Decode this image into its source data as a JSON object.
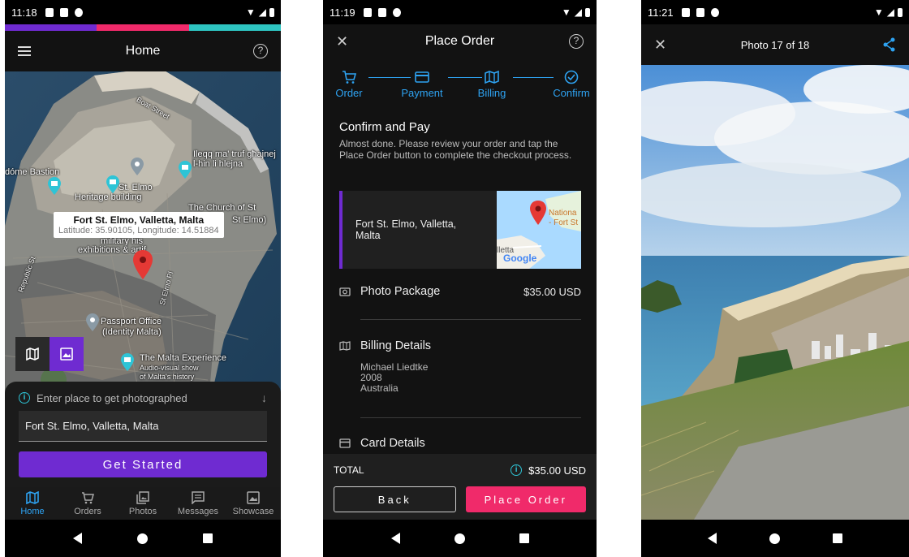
{
  "home": {
    "status": {
      "time": "11:18"
    },
    "stripe": {
      "colors": [
        "#6f2bd1",
        "#f02a6a",
        "#2ec4c1"
      ]
    },
    "header": {
      "title": "Home"
    },
    "map": {
      "labels": {
        "bastion": "dóme Bastion",
        "st_elmo": "St. Elmo",
        "heritage": "Heritage building",
        "church": "The Church of St",
        "church2": "St Elmo)",
        "ileqq": "Ileqq ma' truf għajnej",
        "ilhin": "l-hin li hlejna",
        "military": "military his",
        "exhibitions": "exhibitions & artif",
        "passport": "Passport Office",
        "identity": "(Identity Malta)",
        "malta_exp": "The Malta Experience",
        "audio": "Audio-visual show",
        "history": "of Malta's history",
        "repub": "Republic St",
        "boat": "Boat Street",
        "stelmo_pl": "St Elmo Pl"
      },
      "info_window": {
        "title": "Fort St. Elmo, Valletta, Malta",
        "coords": "Latitude: 35.90105, Longitude: 14.51884"
      }
    },
    "sheet": {
      "hint": "Enter place to get photographed",
      "input_value": "Fort St. Elmo, Valletta, Malta",
      "button": "Get Started"
    },
    "tabs": [
      {
        "label": "Home",
        "icon": "map-icon"
      },
      {
        "label": "Orders",
        "icon": "cart-icon"
      },
      {
        "label": "Photos",
        "icon": "photos-icon"
      },
      {
        "label": "Messages",
        "icon": "message-icon"
      },
      {
        "label": "Showcase",
        "icon": "showcase-icon"
      }
    ]
  },
  "order": {
    "status": {
      "time": "11:19"
    },
    "header": {
      "title": "Place Order"
    },
    "steps": [
      {
        "label": "Order",
        "icon": "cart-icon"
      },
      {
        "label": "Payment",
        "icon": "card-icon"
      },
      {
        "label": "Billing",
        "icon": "map-icon"
      },
      {
        "label": "Confirm",
        "icon": "check-circle-icon"
      }
    ],
    "confirm": {
      "title": "Confirm and Pay",
      "description": "Almost done. Please review your order and tap the Place Order button to complete the checkout process."
    },
    "card": {
      "place": "Fort St. Elmo, Valletta, Malta",
      "map_text_1": "Nationa",
      "map_text_2": "- Fort St",
      "map_text_3": "lletta",
      "google": "Google"
    },
    "photo_package": {
      "label": "Photo Package",
      "price": "$35.00 USD"
    },
    "billing": {
      "label": "Billing Details",
      "name": "Michael Liedtke",
      "postcode": "2008",
      "country": "Australia"
    },
    "card_details": {
      "label": "Card Details"
    },
    "total": {
      "label": "TOTAL",
      "amount": "$35.00 USD"
    },
    "buttons": {
      "back": "Back",
      "place": "Place Order"
    }
  },
  "photo": {
    "status": {
      "time": "11:21"
    },
    "header": {
      "title": "Photo 17 of 18"
    }
  }
}
